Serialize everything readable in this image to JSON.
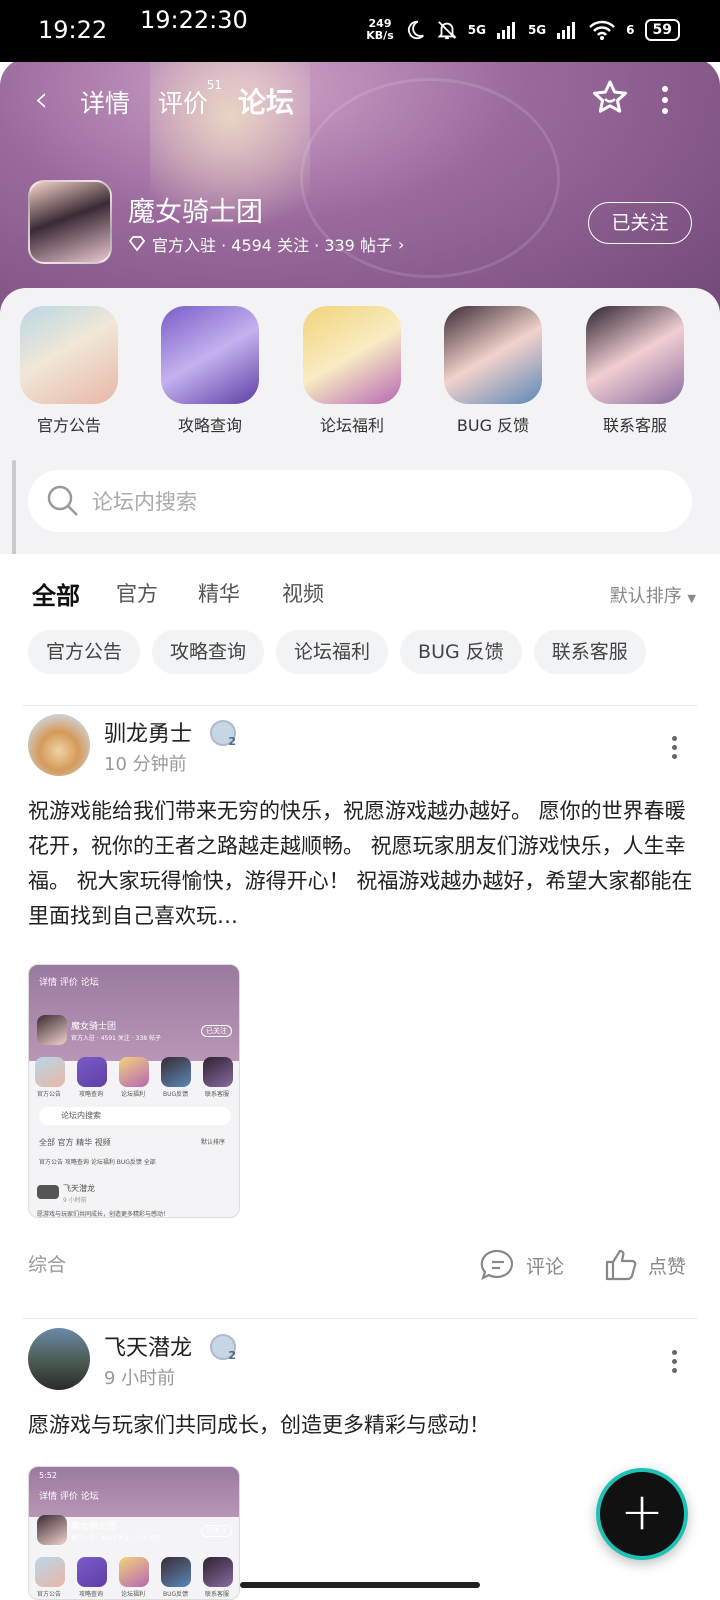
{
  "status_bar": {
    "time": "19:22",
    "clock_overlay": "19:22:30",
    "net_speed_value": "249",
    "net_speed_unit": "KB/s",
    "signal1": "5G",
    "signal2": "5G",
    "wifi_sub": "6",
    "battery": "59"
  },
  "nav": {
    "tabs": [
      {
        "label": "详情"
      },
      {
        "label": "评价",
        "badge": "51"
      },
      {
        "label": "论坛"
      }
    ]
  },
  "game": {
    "name": "魔女骑士团",
    "meta": "官方入驻 · 4594 关注 · 339 帖子",
    "follow_label": "已关注"
  },
  "categories": [
    {
      "label": "官方公告"
    },
    {
      "label": "攻略查询"
    },
    {
      "label": "论坛福利"
    },
    {
      "label": "BUG 反馈"
    },
    {
      "label": "联系客服"
    }
  ],
  "search": {
    "placeholder": "论坛内搜索"
  },
  "filter_tabs": [
    {
      "label": "全部"
    },
    {
      "label": "官方"
    },
    {
      "label": "精华"
    },
    {
      "label": "视频"
    }
  ],
  "sort_label": "默认排序",
  "chips": [
    "官方公告",
    "攻略查询",
    "论坛福利",
    "BUG 反馈",
    "联系客服"
  ],
  "posts": [
    {
      "user": "驯龙勇士",
      "level_badge": "2",
      "time": "10 分钟前",
      "text": "祝游戏能给我们带来无穷的快乐，祝愿游戏越办越好。 愿你的世界春暖花开，祝你的王者之路越走越顺畅。 祝愿玩家朋友们游戏快乐，人生幸福。 祝大家玩得愉快，游得开心！ 祝福游戏越办越好，希望大家都能在里面找到自己喜欢玩…",
      "thumb": {
        "tabs": "详情  评价  论坛",
        "title": "魔女骑士团",
        "meta": "官方入驻 · 4591 关注 · 338 帖子",
        "follow": "已关注",
        "cats": [
          "官方公告",
          "攻略查询",
          "论坛福利",
          "BUG反馈",
          "联系客服"
        ],
        "search": "论坛内搜索",
        "ftabs": "全部  官方  精华  视频",
        "sort": "默认排序",
        "chips": "官方公告  攻略查询  论坛福利  BUG反馈  全部",
        "user": "飞天潜龙",
        "time": "9 小时前",
        "text": "愿游戏与玩家们共同成长，创造更多精彩与感动！"
      },
      "tag": "综合",
      "comment_label": "评论",
      "like_label": "点赞"
    },
    {
      "user": "飞天潜龙",
      "level_badge": "2",
      "time": "9 小时前",
      "text": "愿游戏与玩家们共同成长，创造更多精彩与感动！",
      "thumb": {
        "time": "5:52",
        "tabs": "详情  评价  论坛",
        "title": "魔女骑士团",
        "meta": "官方入驻 · 4562 关注 · 334 帖子",
        "follow": "已关注",
        "cats": [
          "官方公告",
          "攻略查询",
          "论坛福利",
          "BUG反馈",
          "联系客服"
        ]
      }
    }
  ],
  "colors": {
    "accent": "#20d0c0",
    "hero": "#8e5f90",
    "sheet": "#f3f3f6"
  }
}
